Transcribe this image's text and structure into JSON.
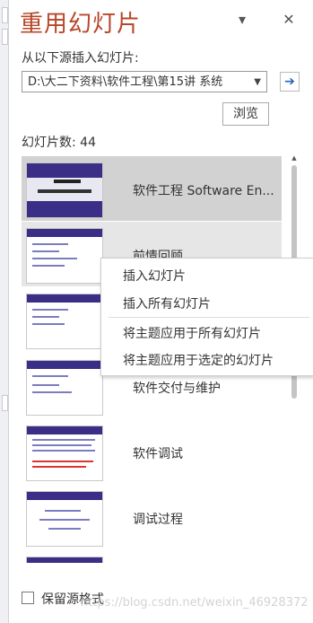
{
  "pane": {
    "title": "重用幻灯片",
    "dropdown_icon": "chevron-down-icon",
    "close_icon": "close-icon",
    "source_label": "从以下源插入幻灯片:",
    "path_value": "D:\\大二下资料\\软件工程\\第15讲 系统",
    "go_icon": "arrow-right-icon",
    "browse_label": "浏览",
    "slide_count": "幻灯片数: 44",
    "keep_format_label": "保留源格式",
    "watermark": "https://blog.csdn.net/weixin_46928372"
  },
  "slides": [
    {
      "label": "软件工程 Software   En..."
    },
    {
      "label": "前情回顾"
    },
    {
      "label": ""
    },
    {
      "label": "软件交付与维护"
    },
    {
      "label": "软件调试"
    },
    {
      "label": "调试过程"
    },
    {
      "label": ""
    }
  ],
  "context_menu": {
    "items": [
      "插入幻灯片",
      "插入所有幻灯片",
      "将主题应用于所有幻灯片",
      "将主题应用于选定的幻灯片"
    ]
  }
}
